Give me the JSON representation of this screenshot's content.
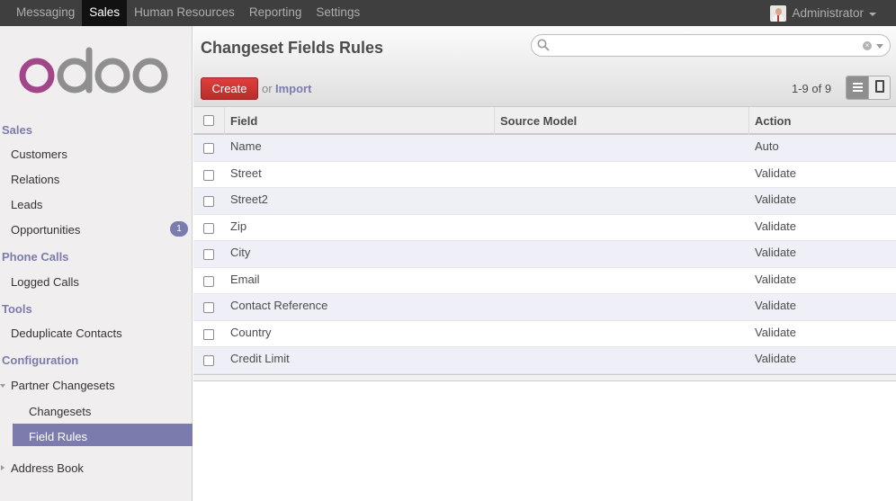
{
  "topmenu": [
    {
      "label": "Messaging",
      "active": false
    },
    {
      "label": "Sales",
      "active": true
    },
    {
      "label": "Human Resources",
      "active": false
    },
    {
      "label": "Reporting",
      "active": false
    },
    {
      "label": "Settings",
      "active": false
    }
  ],
  "user": {
    "name": "Administrator"
  },
  "sidebar": {
    "logo_text": "odoo",
    "sales": {
      "title": "Sales",
      "items": [
        {
          "label": "Customers"
        },
        {
          "label": "Relations"
        },
        {
          "label": "Leads"
        },
        {
          "label": "Opportunities",
          "badge": "1"
        }
      ]
    },
    "phone_calls": {
      "title": "Phone Calls",
      "items": [
        {
          "label": "Logged Calls"
        }
      ]
    },
    "tools": {
      "title": "Tools",
      "items": [
        {
          "label": "Deduplicate Contacts"
        }
      ]
    },
    "configuration": {
      "title": "Configuration",
      "partner_changesets": "Partner Changesets",
      "changesets": "Changesets",
      "field_rules": "Field Rules",
      "address_book": "Address Book"
    }
  },
  "content": {
    "title": "Changeset Fields Rules",
    "search": {
      "value": "",
      "placeholder": ""
    },
    "create_label": "Create",
    "or_label": "or",
    "import_label": "Import",
    "pager": "1-9 of 9",
    "columns": [
      "Field",
      "Source Model",
      "Action"
    ],
    "rows": [
      {
        "field": "Name",
        "model": "",
        "action": "Auto"
      },
      {
        "field": "Street",
        "model": "",
        "action": "Validate"
      },
      {
        "field": "Street2",
        "model": "",
        "action": "Validate"
      },
      {
        "field": "Zip",
        "model": "",
        "action": "Validate"
      },
      {
        "field": "City",
        "model": "",
        "action": "Validate"
      },
      {
        "field": "Email",
        "model": "",
        "action": "Validate"
      },
      {
        "field": "Contact Reference",
        "model": "",
        "action": "Validate"
      },
      {
        "field": "Country",
        "model": "",
        "action": "Validate"
      },
      {
        "field": "Credit Limit",
        "model": "",
        "action": "Validate"
      }
    ]
  },
  "colors": {
    "accent": "#7c7bad",
    "create_button": "#c9302c",
    "topbar": "#3f3f3f"
  }
}
